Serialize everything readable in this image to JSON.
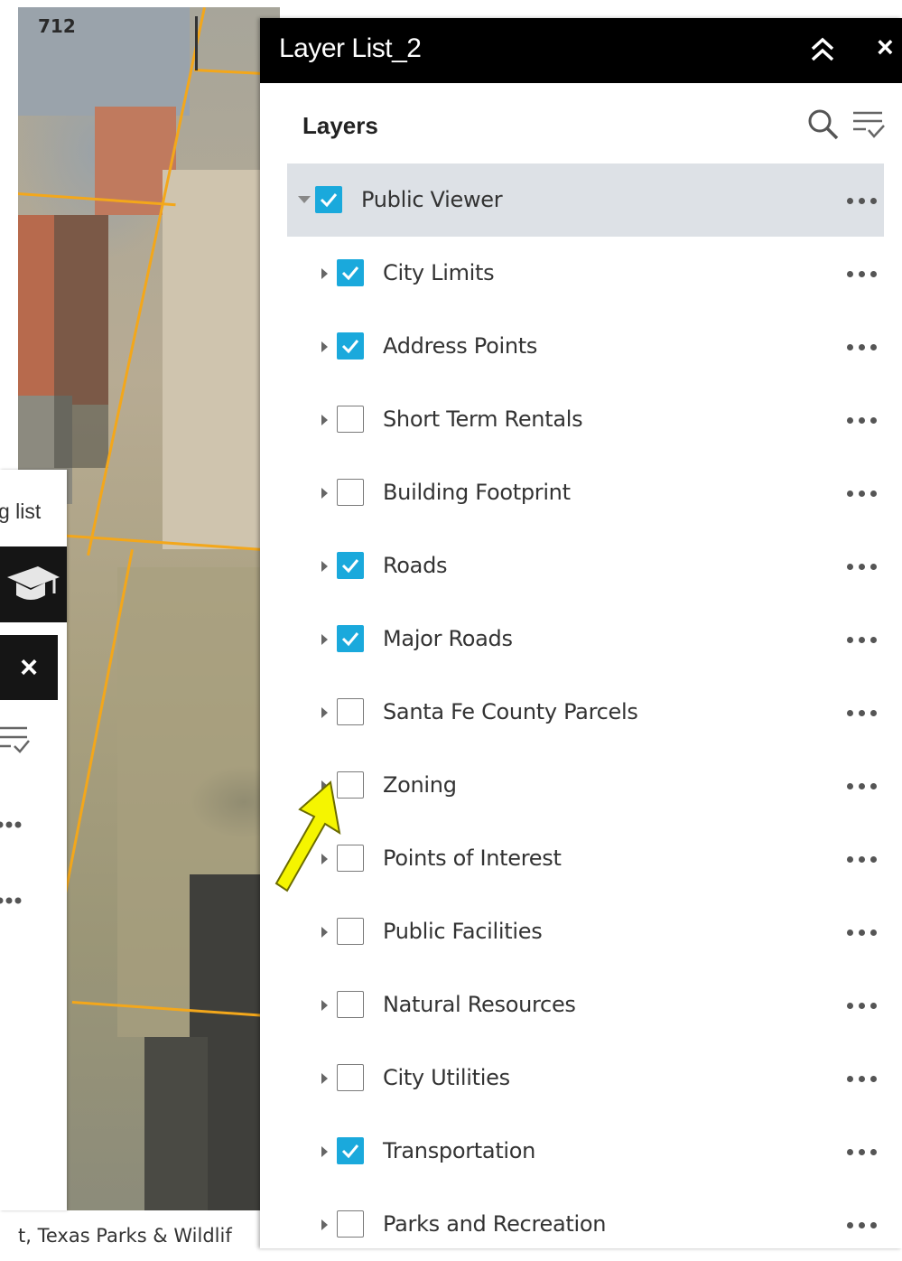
{
  "map": {
    "parcel_label": "712",
    "attribution": "t, Texas Parks & Wildlif"
  },
  "left_panel": {
    "partial_label": "g list",
    "close_glyph": "×",
    "icons": [
      "graduation-cap-icon",
      "filter-list-icon",
      "more-icon"
    ]
  },
  "layer_list": {
    "title": "Layer List_2",
    "section_title": "Layers",
    "tools": [
      "search-icon",
      "filter-list-icon"
    ],
    "header_buttons": [
      "collapse-icon",
      "close-icon"
    ],
    "close_glyph": "×",
    "accent_color": "#1aa9dc",
    "group": {
      "label": "Public Viewer",
      "checked": true,
      "expanded": true
    },
    "items": [
      {
        "label": "City Limits",
        "checked": true
      },
      {
        "label": "Address Points",
        "checked": true
      },
      {
        "label": "Short Term Rentals",
        "checked": false
      },
      {
        "label": "Building Footprint",
        "checked": false
      },
      {
        "label": "Roads",
        "checked": true
      },
      {
        "label": "Major Roads",
        "checked": true
      },
      {
        "label": "Santa Fe County Parcels",
        "checked": false
      },
      {
        "label": "Zoning",
        "checked": false
      },
      {
        "label": "Points of Interest",
        "checked": false
      },
      {
        "label": "Public Facilities",
        "checked": false
      },
      {
        "label": "Natural Resources",
        "checked": false
      },
      {
        "label": "City Utilities",
        "checked": false
      },
      {
        "label": "Transportation",
        "checked": true
      },
      {
        "label": "Parks and Recreation",
        "checked": false
      }
    ]
  },
  "annotation": {
    "arrow_color": "#f5f500",
    "points_to": "Zoning expand caret"
  }
}
